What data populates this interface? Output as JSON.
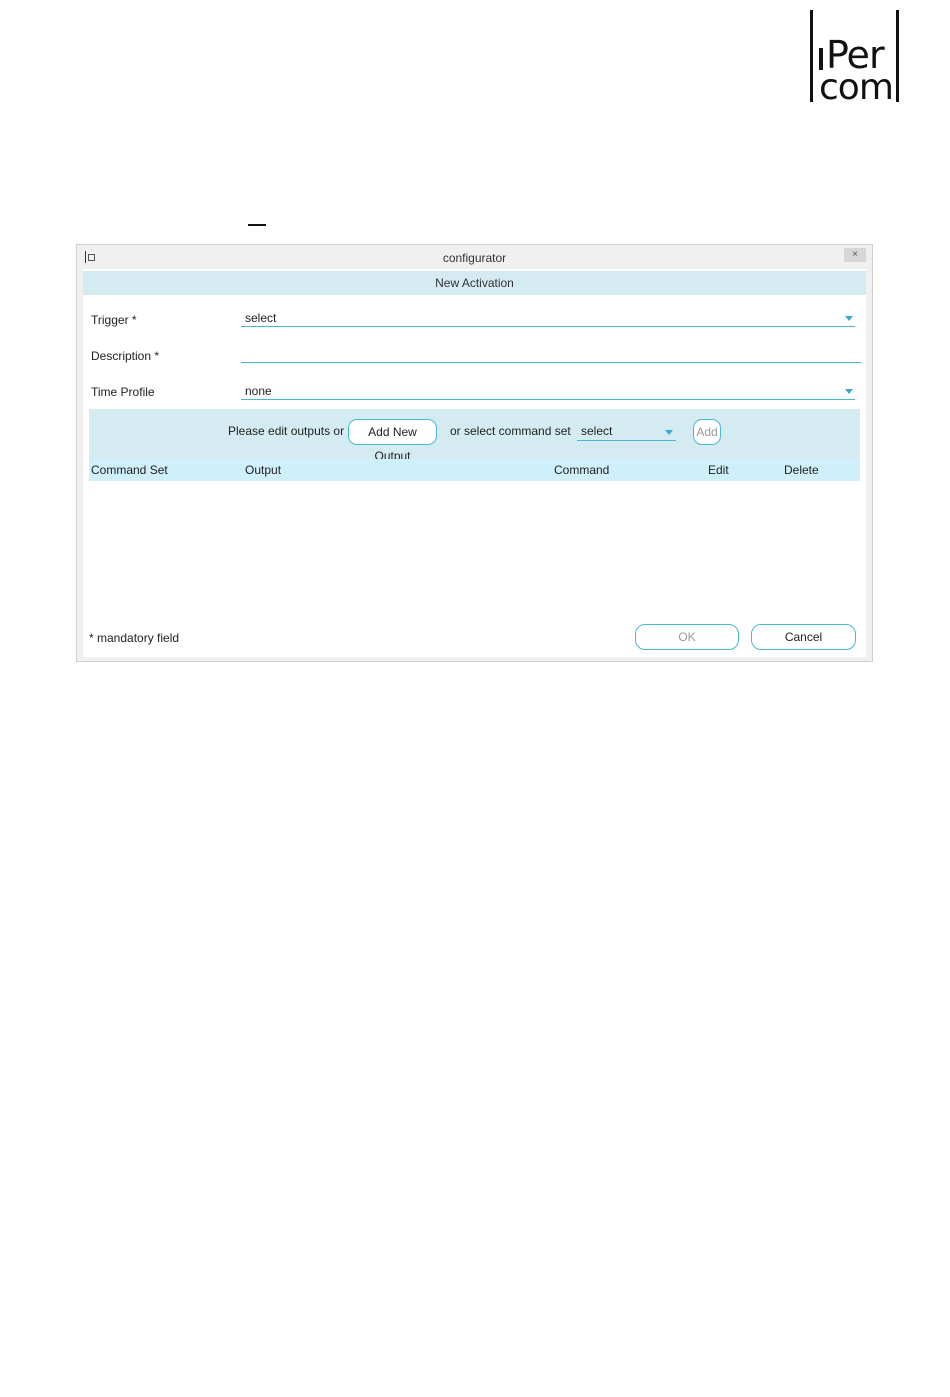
{
  "logo": {
    "line1": "Per",
    "line2": "com"
  },
  "window": {
    "title": "configurator",
    "close_label": "×",
    "header": "New Activation"
  },
  "form": {
    "trigger": {
      "label": "Trigger *",
      "value": "select"
    },
    "description": {
      "label": "Description *",
      "value": ""
    },
    "time_profile": {
      "label": "Time Profile",
      "value": "none"
    }
  },
  "command_bar": {
    "prompt": "Please edit outputs or",
    "add_new_output": "Add New Output",
    "or_select": "or select command set",
    "command_set_value": "select",
    "add": "Add"
  },
  "table": {
    "columns": [
      "Command Set",
      "Output",
      "Command",
      "Edit",
      "Delete"
    ],
    "rows": []
  },
  "footer": {
    "mandatory_note": "* mandatory field",
    "ok": "OK",
    "cancel": "Cancel"
  },
  "colors": {
    "accent": "#4ab8d2",
    "band": "#d4ebf1",
    "table_header": "#cfeffa"
  }
}
